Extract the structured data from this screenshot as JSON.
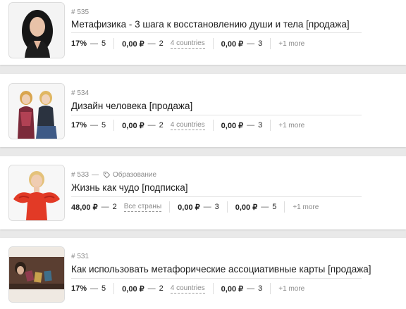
{
  "items": [
    {
      "id": "# 535",
      "tag": "",
      "title": "Метафизика - 3 шага к восстановлению души и тела [продажа]",
      "o1": {
        "rate": "17%",
        "dash": "—",
        "num": "5",
        "countries": ""
      },
      "o2": {
        "rate": "0,00 ₽",
        "dash": "—",
        "num": "2",
        "countries": "4 countries"
      },
      "o3": {
        "rate": "0,00 ₽",
        "dash": "—",
        "num": "3",
        "countries": ""
      },
      "more": "+1 more"
    },
    {
      "id": "# 534",
      "tag": "",
      "title": "Дизайн человека [продажа]",
      "o1": {
        "rate": "17%",
        "dash": "—",
        "num": "5",
        "countries": ""
      },
      "o2": {
        "rate": "0,00 ₽",
        "dash": "—",
        "num": "2",
        "countries": "4 countries"
      },
      "o3": {
        "rate": "0,00 ₽",
        "dash": "—",
        "num": "3",
        "countries": ""
      },
      "more": "+1 more"
    },
    {
      "id": "# 533",
      "sep": "—",
      "tag": "Образование",
      "title": "Жизнь как чудо [подписка]",
      "o1": {
        "rate": "48,00 ₽",
        "dash": "—",
        "num": "2",
        "countries": "Все страны"
      },
      "o2": {
        "rate": "0,00 ₽",
        "dash": "—",
        "num": "3",
        "countries": ""
      },
      "o3": {
        "rate": "0,00 ₽",
        "dash": "—",
        "num": "5",
        "countries": ""
      },
      "more": "+1 more"
    },
    {
      "id": "# 531",
      "tag": "",
      "title": "Как использовать метафорические ассоциативные карты [продажа]",
      "o1": {
        "rate": "17%",
        "dash": "—",
        "num": "5",
        "countries": ""
      },
      "o2": {
        "rate": "0,00 ₽",
        "dash": "—",
        "num": "2",
        "countries": "4 countries"
      },
      "o3": {
        "rate": "0,00 ₽",
        "dash": "—",
        "num": "3",
        "countries": ""
      },
      "more": "+1 more"
    }
  ],
  "colors": {
    "muted": "#8a8a8a",
    "text": "#1b1b1b",
    "page_bg": "#e9e9e9"
  },
  "icons": {
    "tag": "tag-icon"
  }
}
